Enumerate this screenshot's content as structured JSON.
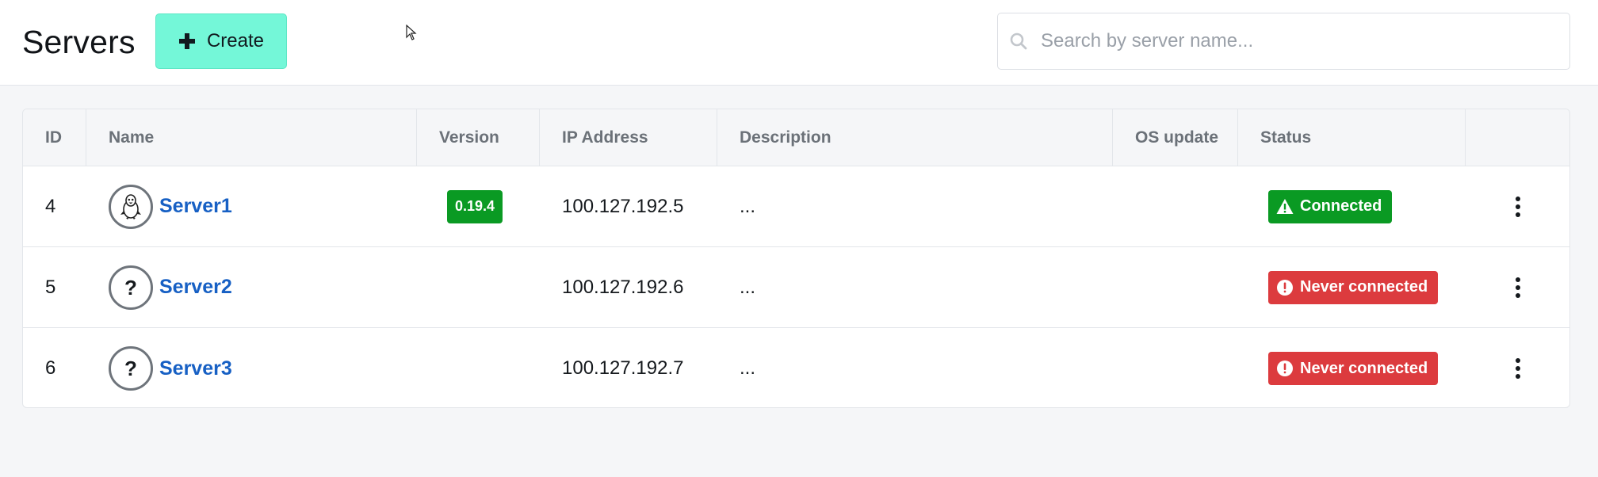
{
  "header": {
    "title": "Servers",
    "create_label": "Create",
    "search_placeholder": "Search by server name..."
  },
  "table": {
    "columns": [
      "ID",
      "Name",
      "Version",
      "IP Address",
      "Description",
      "OS update",
      "Status",
      ""
    ],
    "rows": [
      {
        "id": "4",
        "name": "Server1",
        "icon": "linux-penguin-icon",
        "version": "0.19.4",
        "ip": "100.127.192.5",
        "description": "...",
        "os_update": "",
        "status": "Connected",
        "status_type": "connected"
      },
      {
        "id": "5",
        "name": "Server2",
        "icon": "question-mark-icon",
        "version": "",
        "ip": "100.127.192.6",
        "description": "...",
        "os_update": "",
        "status": "Never connected",
        "status_type": "never-connected"
      },
      {
        "id": "6",
        "name": "Server3",
        "icon": "question-mark-icon",
        "version": "",
        "ip": "100.127.192.7",
        "description": "...",
        "os_update": "",
        "status": "Never connected",
        "status_type": "never-connected"
      }
    ]
  },
  "colors": {
    "accent": "#74f7d8",
    "link": "#1760c4",
    "success": "#0a9a23",
    "danger": "#dc3b3e"
  }
}
